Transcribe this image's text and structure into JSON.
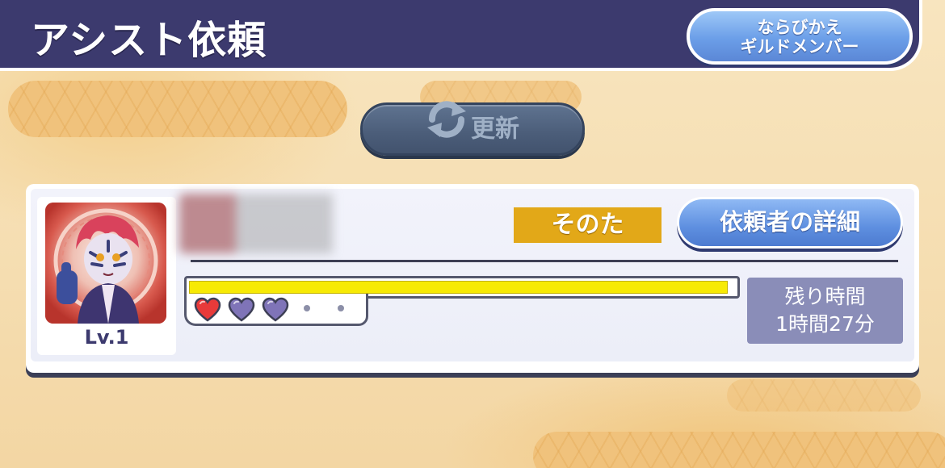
{
  "header": {
    "title": "アシスト依頼",
    "sort_button": {
      "line1": "ならびかえ",
      "line2": "ギルドメンバー"
    }
  },
  "refresh_button": {
    "label": "更新",
    "icon": "refresh-icon"
  },
  "request_card": {
    "level": "Lv.1",
    "category": "そのた",
    "detail_button": "依頼者の詳細",
    "progress_fraction": 0.99,
    "hearts": {
      "total": 3,
      "filled": 1,
      "filled_color": "#e83a3a",
      "empty_color": "#7f74b8"
    },
    "remaining": {
      "label": "残り時間",
      "value": "1時間27分"
    }
  },
  "colors": {
    "header_bg": "#3c3a6e",
    "button_blue": "#5e8fe0",
    "category_gold": "#e2a818",
    "progress_yellow": "#f7ea05",
    "time_box_bg": "#8a8db8"
  }
}
